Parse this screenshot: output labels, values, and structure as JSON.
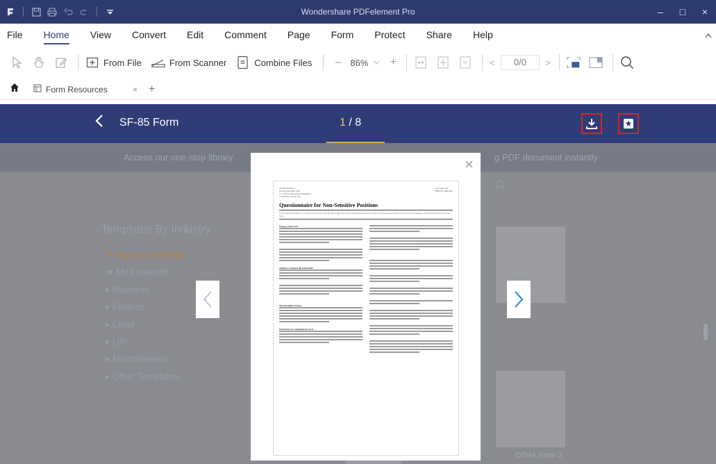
{
  "app": {
    "title": "Wondershare PDFelement Pro",
    "quick_access_icons": [
      "app-logo-icon",
      "save-icon",
      "print-icon",
      "undo-icon",
      "redo-icon",
      "customize-quick-access-icon"
    ],
    "window_controls": {
      "minimize": "–",
      "maximize": "□",
      "close": "×"
    }
  },
  "menu": {
    "items": [
      "File",
      "Home",
      "View",
      "Convert",
      "Edit",
      "Comment",
      "Page",
      "Form",
      "Protect",
      "Share",
      "Help"
    ],
    "active": "Home"
  },
  "toolbar": {
    "from_file": "From File",
    "from_scanner": "From Scanner",
    "combine_files": "Combine Files",
    "zoom_value": "86%",
    "zoom_minus": "–",
    "zoom_plus": "+",
    "page_value": "0/0",
    "prev": "<",
    "next": ">"
  },
  "tabs": {
    "items": [
      {
        "label": "Form Resources",
        "close": "×"
      }
    ],
    "add": "+"
  },
  "form_header": {
    "back": "<",
    "title": "SF-85 Form",
    "page_current": "1",
    "page_total": "/ 8"
  },
  "promo": {
    "left": "Access our one-stop library",
    "right": "g PDF document instantly"
  },
  "categories": {
    "title": "Templates By Industry",
    "items": [
      "Popular Template",
      "My Favourite",
      "Business",
      "Finance",
      "Legal",
      "Life",
      "Miscellaneous",
      "Other Templates"
    ]
  },
  "background_thumb_label": "OTHA Form 2",
  "preview": {
    "close": "×",
    "prev": "<",
    "next": ">",
    "doc_header_left": "Standard Form 85\nRevised September 1995\nU.S. Office of Personnel Management\n5 CFR Parts 731 and 736",
    "doc_header_right": "Form approved:\nOMB No. 3206-0005",
    "doc_title": "Questionnaire for Non-Sensitive Positions",
    "doc_intro": "Follow instructions fully or we cannot process your form. Be sure to sign and date the certification statement on Page 5 and the release on Page 6. If you have any questions, call the office that gave you the form.",
    "sections": [
      "Purpose of this Form",
      "Authority to Request this Information",
      "The Investigative Process",
      "Instructions for Completing this Form"
    ]
  },
  "colors": {
    "title_bar": "#2d3a6e",
    "header_blue": "#2f3c77",
    "highlight_red": "#d4262b",
    "accent_gold": "#d8a455"
  }
}
